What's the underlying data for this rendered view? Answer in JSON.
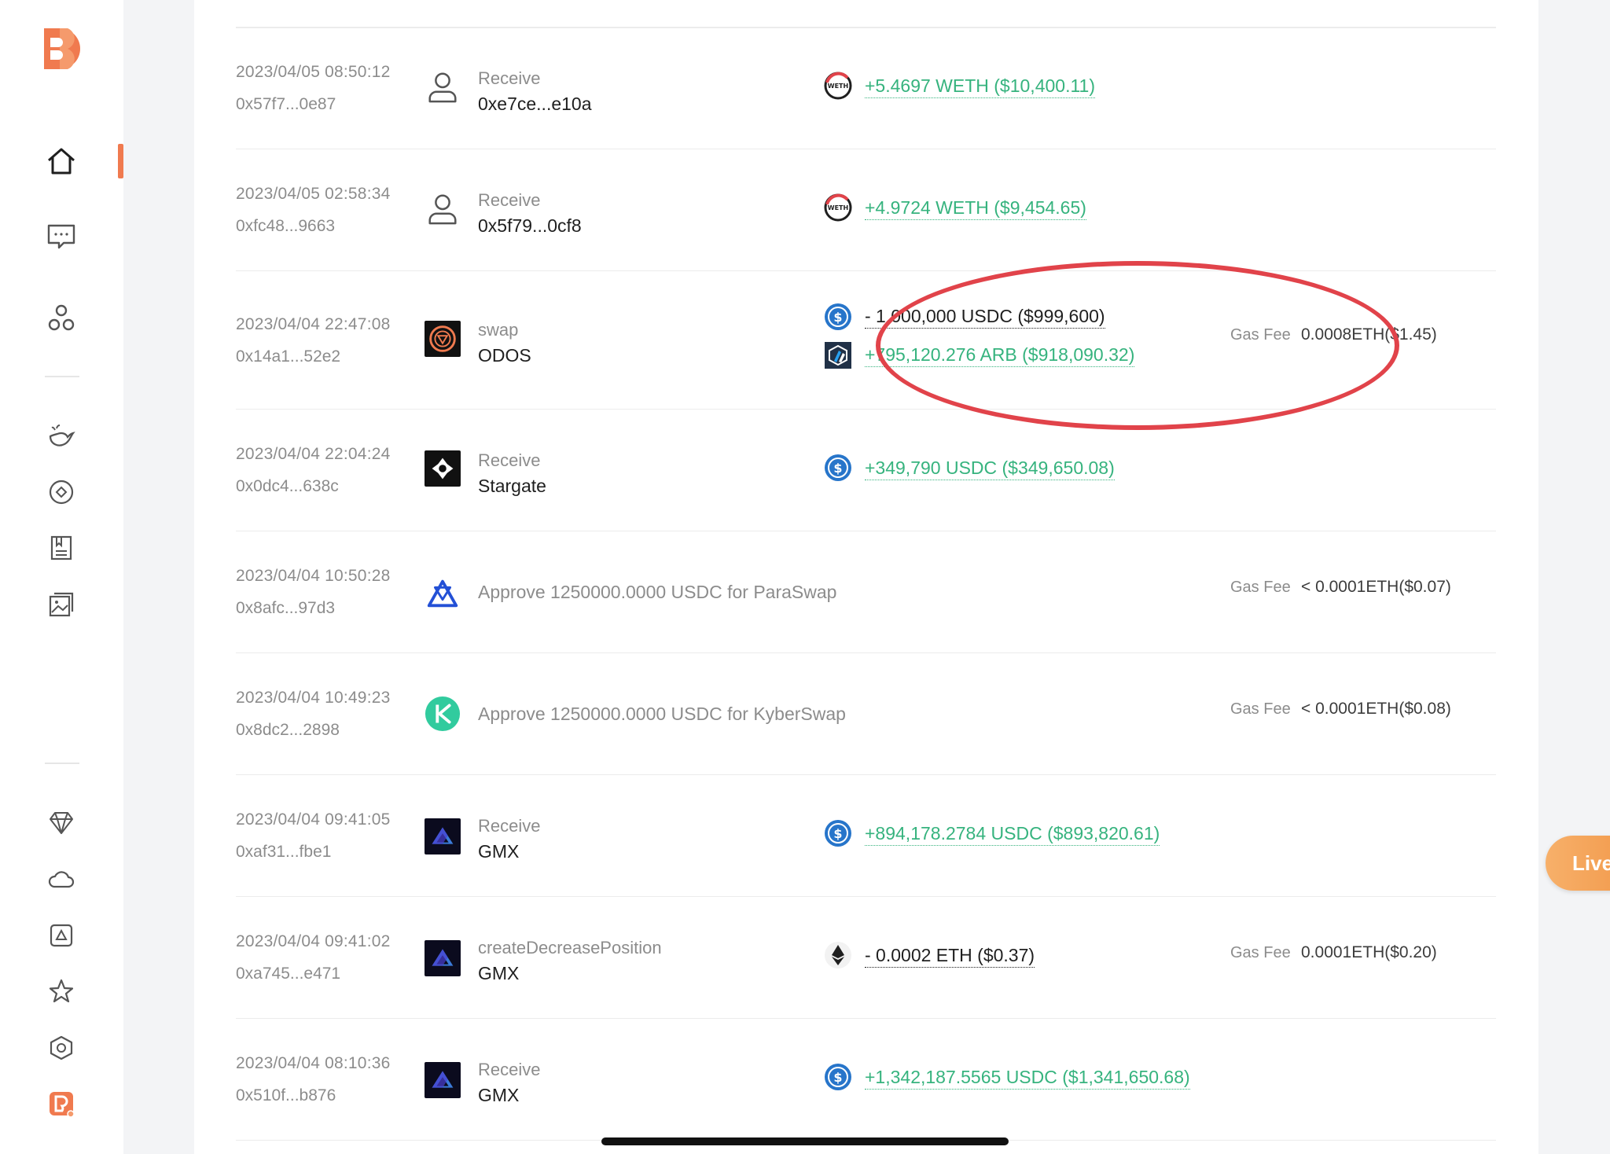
{
  "colors": {
    "accent": "#f07a4f",
    "positive": "#36b37e",
    "annotation_circle": "#e1434a",
    "live_button": "#f29a4c"
  },
  "sidebar": {
    "logo": "logo-icon",
    "items": [
      {
        "icon": "home-icon",
        "active": true
      },
      {
        "icon": "message-icon"
      },
      {
        "icon": "community-icon"
      },
      {
        "icon": "whale-icon"
      },
      {
        "icon": "target-icon"
      },
      {
        "icon": "bookmark-icon"
      },
      {
        "icon": "gallery-icon"
      },
      {
        "icon": "diamond-icon"
      },
      {
        "icon": "cloud-icon"
      },
      {
        "icon": "box-icon"
      },
      {
        "icon": "star-icon"
      },
      {
        "icon": "hexagon-icon"
      },
      {
        "icon": "app-badge-icon"
      }
    ]
  },
  "transactions": [
    {
      "time": "2023/04/05 08:50:12",
      "hash": "0x57f7...0e87",
      "action": "Receive",
      "party": "0xe7ce...e10a",
      "amounts": [
        {
          "text": "+5.4697 WETH ($10,400.11)",
          "token": "weth-icon"
        }
      ]
    },
    {
      "time": "2023/04/05 02:58:34",
      "hash": "0xfc48...9663",
      "action": "Receive",
      "party": "0x5f79...0cf8",
      "amounts": [
        {
          "text": "+4.9724 WETH ($9,454.65)",
          "token": "weth-icon"
        }
      ]
    },
    {
      "time": "2023/04/04 22:47:08",
      "hash": "0x14a1...52e2",
      "action": "swap",
      "party": "ODOS",
      "amounts": [
        {
          "text": "- 1,000,000 USDC ($999,600)",
          "token": "usdc-icon"
        },
        {
          "text": "+795,120.276 ARB ($918,090.32)",
          "token": "arb-icon"
        }
      ],
      "gas_label": "Gas Fee",
      "gas": "0.0008ETH($1.45)"
    },
    {
      "time": "2023/04/04 22:04:24",
      "hash": "0x0dc4...638c",
      "action": "Receive",
      "party": "Stargate",
      "amounts": [
        {
          "text": "+349,790 USDC ($349,650.08)",
          "token": "usdc-icon"
        }
      ]
    },
    {
      "time": "2023/04/04 10:50:28",
      "hash": "0x8afc...97d3",
      "approve": "Approve 1250000.0000 USDC for ParaSwap",
      "gas_label": "Gas Fee",
      "gas": "< 0.0001ETH($0.07)"
    },
    {
      "time": "2023/04/04 10:49:23",
      "hash": "0x8dc2...2898",
      "approve": "Approve 1250000.0000 USDC for KyberSwap",
      "gas_label": "Gas Fee",
      "gas": "< 0.0001ETH($0.08)"
    },
    {
      "time": "2023/04/04 09:41:05",
      "hash": "0xaf31...fbe1",
      "action": "Receive",
      "party": "GMX",
      "amounts": [
        {
          "text": "+894,178.2784 USDC ($893,820.61)",
          "token": "usdc-icon"
        }
      ]
    },
    {
      "time": "2023/04/04 09:41:02",
      "hash": "0xa745...e471",
      "action": "createDecreasePosition",
      "party": "GMX",
      "amounts": [
        {
          "text": "- 0.0002 ETH ($0.37)",
          "token": "eth-icon"
        }
      ],
      "gas_label": "Gas Fee",
      "gas": "0.0001ETH($0.20)"
    },
    {
      "time": "2023/04/04 08:10:36",
      "hash": "0x510f...b876",
      "action": "Receive",
      "party": "GMX",
      "amounts": [
        {
          "text": "+1,342,187.5565 USDC ($1,341,650.68)",
          "token": "usdc-icon"
        }
      ]
    }
  ],
  "live_button": {
    "label": "Live"
  }
}
